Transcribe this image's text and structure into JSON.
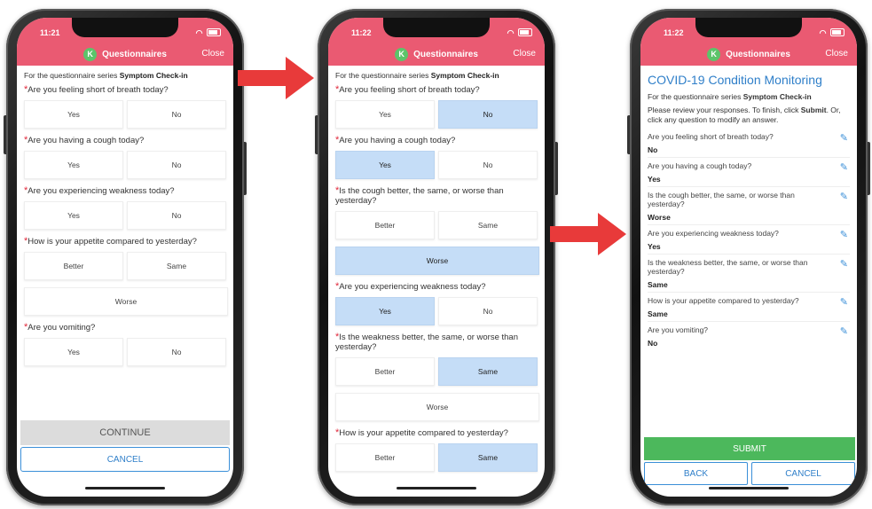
{
  "header": {
    "avatar_letter": "K",
    "title": "Questionnaires",
    "close_label": "Close"
  },
  "status_times": [
    "11:21",
    "11:22",
    "11:22"
  ],
  "series_prefix": "For the questionnaire series ",
  "series_name": "Symptom Check-in",
  "screen1": {
    "questions": [
      {
        "text": "Are you feeling short of breath today?",
        "options": [
          "Yes",
          "No"
        ]
      },
      {
        "text": "Are you having a cough today?",
        "options": [
          "Yes",
          "No"
        ]
      },
      {
        "text": "Are you experiencing weakness today?",
        "options": [
          "Yes",
          "No"
        ]
      },
      {
        "text": "How is your appetite compared to yesterday?",
        "options": [
          "Better",
          "Same"
        ],
        "extra_option": "Worse"
      },
      {
        "text": "Are you vomiting?",
        "options": [
          "Yes",
          "No"
        ]
      }
    ],
    "continue_label": "CONTINUE",
    "cancel_label": "CANCEL"
  },
  "screen2": {
    "questions": [
      {
        "text": "Are you feeling short of breath today?",
        "options": [
          "Yes",
          "No"
        ],
        "selected": "No"
      },
      {
        "text": "Are you having a cough today?",
        "options": [
          "Yes",
          "No"
        ],
        "selected": "Yes"
      },
      {
        "text": "Is the cough better, the same, or worse than yesterday?",
        "options": [
          "Better",
          "Same"
        ],
        "extra_option": "Worse",
        "selected": "Worse"
      },
      {
        "text": "Are you experiencing weakness today?",
        "options": [
          "Yes",
          "No"
        ],
        "selected": "Yes"
      },
      {
        "text": "Is the weakness better, the same, or worse than yesterday?",
        "options": [
          "Better",
          "Same"
        ],
        "extra_option": "Worse",
        "selected": "Same"
      },
      {
        "text": "How is your appetite compared to yesterday?",
        "options": [
          "Better",
          "Same"
        ],
        "selected": "Same"
      }
    ]
  },
  "screen3": {
    "title": "COVID-19 Condition Monitoring",
    "instructions_1": "Please review your responses. To finish, click ",
    "instructions_submit": "Submit",
    "instructions_2": ". Or, click any question to modify an answer.",
    "answers": [
      {
        "q": "Are you feeling short of breath today?",
        "a": "No"
      },
      {
        "q": "Are you having a cough today?",
        "a": "Yes"
      },
      {
        "q": "Is the cough better, the same, or worse than yesterday?",
        "a": "Worse"
      },
      {
        "q": "Are you experiencing weakness today?",
        "a": "Yes"
      },
      {
        "q": "Is the weakness better, the same, or worse than yesterday?",
        "a": "Same"
      },
      {
        "q": "How is your appetite compared to yesterday?",
        "a": "Same"
      },
      {
        "q": "Are you vomiting?",
        "a": "No"
      }
    ],
    "submit_label": "SUBMIT",
    "back_label": "BACK",
    "cancel_label": "CANCEL"
  },
  "colors": {
    "header_pink": "#ea5a72",
    "selected_blue": "#c5ddf7",
    "link_blue": "#2f7fc9",
    "submit_green": "#4cb85c",
    "arrow_red": "#e83a3a"
  }
}
